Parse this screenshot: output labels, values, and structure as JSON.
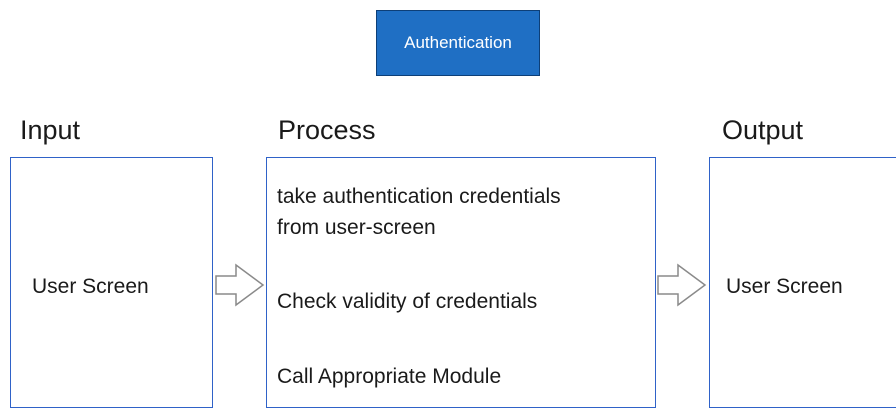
{
  "header": {
    "title": "Authentication",
    "title_color": "#1f6fc4"
  },
  "columns": {
    "input": {
      "heading": "Input",
      "box_text": "User Screen"
    },
    "process": {
      "heading": "Process",
      "steps": [
        "take authentication credentials",
        "from user-screen",
        "Check validity of credentials",
        "Call Appropriate Module"
      ]
    },
    "output": {
      "heading": "Output",
      "box_text": "User Screen"
    }
  },
  "style": {
    "box_border_color": "#2f62c8",
    "arrow_color": "#8a8a8a"
  },
  "connectors": [
    {
      "from": "input",
      "to": "process",
      "icon": "arrow-right-icon"
    },
    {
      "from": "process",
      "to": "output",
      "icon": "arrow-right-icon"
    }
  ]
}
